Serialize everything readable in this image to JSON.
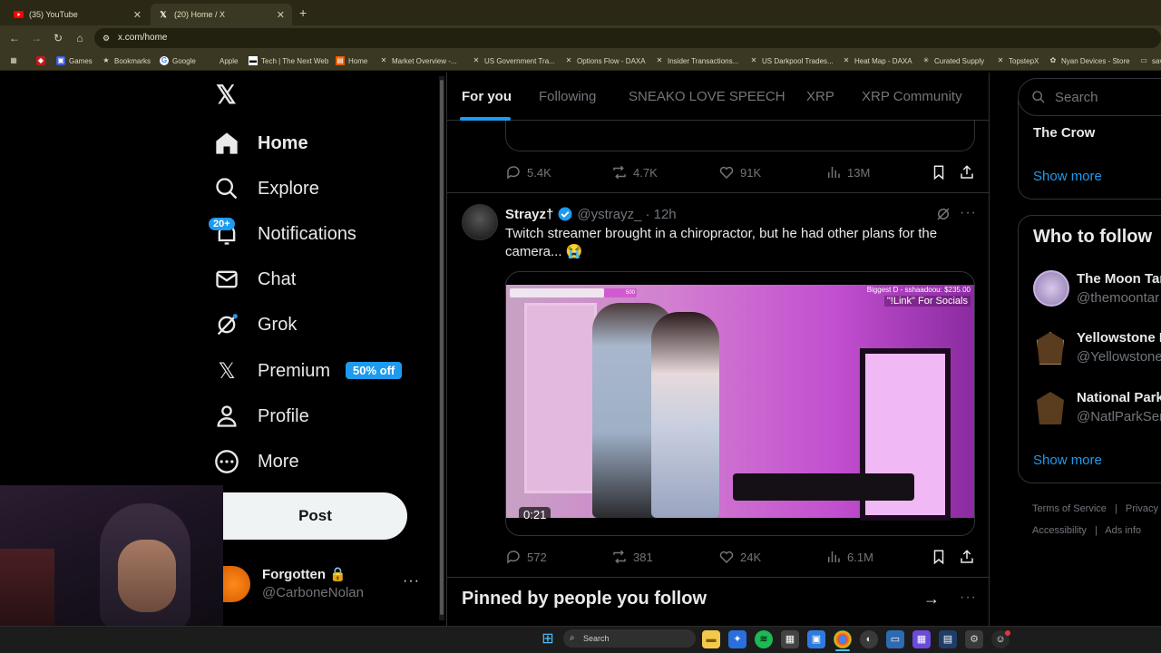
{
  "browser": {
    "tabs": [
      {
        "title": "(35) YouTube",
        "icon": "youtube-icon"
      },
      {
        "title": "(20) Home / X",
        "icon": "x-logo-icon"
      }
    ],
    "url": "x.com/home",
    "bookmarks": [
      "Games",
      "Bookmarks",
      "Google",
      "Apple",
      "Tech | The Next Web",
      "Home",
      "Market Overview -...",
      "US Government Tra...",
      "Options Flow - DAXA",
      "Insider Transactions...",
      "US Darkpool Trades...",
      "Heat Map - DAXA",
      "Curated Supply",
      "TopstepX",
      "Nyan Devices - Store",
      "sav"
    ]
  },
  "nav": {
    "home": "Home",
    "explore": "Explore",
    "notifications": "Notifications",
    "notifications_badge": "20+",
    "chat": "Chat",
    "grok": "Grok",
    "premium": "Premium",
    "premium_badge": "50% off",
    "profile": "Profile",
    "more": "More",
    "post": "Post"
  },
  "account": {
    "name": "Forgotten",
    "handle": "@CarboneNolan"
  },
  "feed": {
    "tabs": [
      "For you",
      "Following",
      "SNEAKO LOVE SPEECH",
      "XRP",
      "XRP Community"
    ],
    "prev_post_actions": {
      "replies": "5.4K",
      "reposts": "4.7K",
      "likes": "91K",
      "views": "13M"
    },
    "post": {
      "author": "Strayz†",
      "handle": "@ystrayz_",
      "time": "· 12h",
      "text": "Twitch streamer brought in a chiropractor, but he had other plans for the camera... 😭",
      "video_duration": "0:21",
      "overlay_top": "Biggest D - sshaadoou: $235.00",
      "overlay_link": "\"!Link\" For Socials",
      "overlay_progress": "500",
      "replies": "572",
      "reposts": "381",
      "likes": "24K",
      "views": "6.1M"
    },
    "pinned_heading": "Pinned by people you follow"
  },
  "right": {
    "search_placeholder": "Search",
    "trend_name": "The Crow",
    "show_more_1": "Show more",
    "who_to_follow": "Who to follow",
    "follow": [
      {
        "name": "The Moon Tar",
        "handle": "@themoontar"
      },
      {
        "name": "Yellowstone I",
        "handle": "@Yellowstone"
      },
      {
        "name": "National Park",
        "handle": "@NatlParkSer"
      }
    ],
    "show_more_2": "Show more",
    "footer": [
      "Terms of Service",
      "|",
      "Privacy",
      "Accessibility",
      "|",
      "Ads info"
    ]
  },
  "taskbar": {
    "search": "Search"
  },
  "colors": {
    "accent": "#1d9bf0",
    "bg": "#000000",
    "muted": "#71767b",
    "border": "#2f3336"
  }
}
